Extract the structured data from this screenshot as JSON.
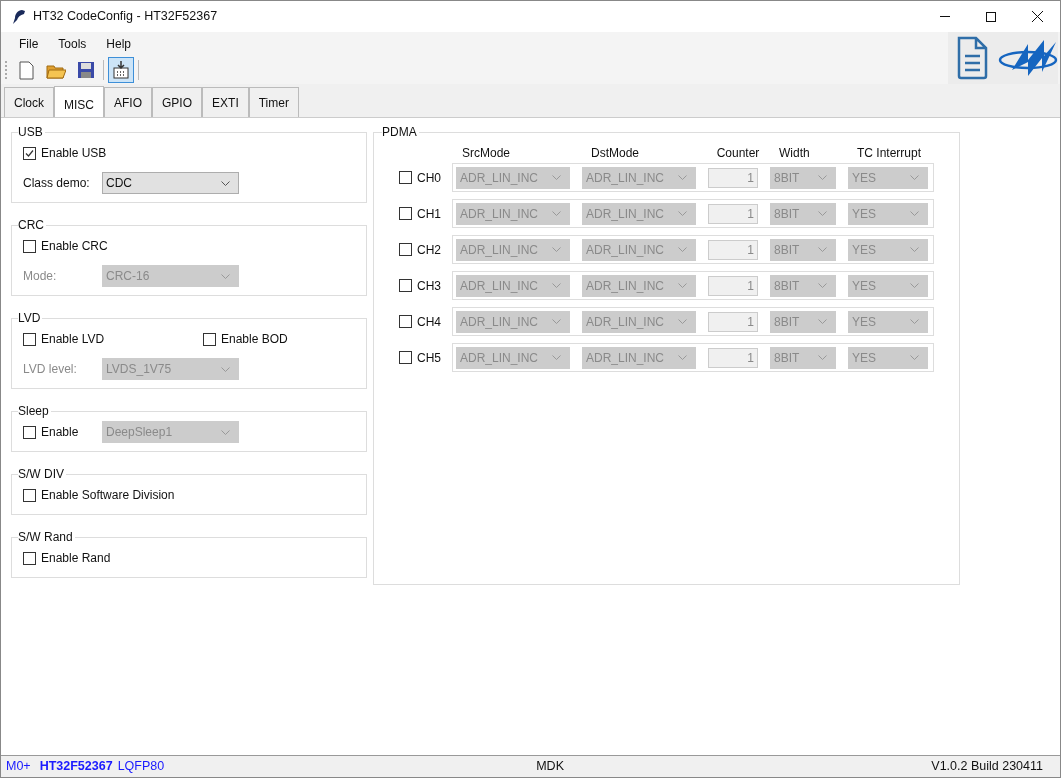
{
  "window": {
    "title": "HT32 CodeConfig - HT32F52367"
  },
  "menu": [
    "File",
    "Tools",
    "Help"
  ],
  "toolbar": [
    {
      "kind": "new",
      "highlighted": false
    },
    {
      "kind": "open",
      "highlighted": false
    },
    {
      "kind": "save",
      "highlighted": false
    },
    {
      "kind": "generate",
      "highlighted": true
    }
  ],
  "tabs": [
    {
      "label": "Clock",
      "selected": false
    },
    {
      "label": "MISC",
      "selected": true
    },
    {
      "label": "AFIO",
      "selected": false
    },
    {
      "label": "GPIO",
      "selected": false
    },
    {
      "label": "EXTI",
      "selected": false
    },
    {
      "label": "Timer",
      "selected": false
    }
  ],
  "groups": [
    {
      "title": "USB",
      "rows": [
        [
          {
            "kind": "checkbox",
            "label": "Enable USB",
            "checked": true
          }
        ],
        [
          {
            "kind": "select",
            "label": "Class demo:",
            "value": "CDC",
            "disabled": false
          }
        ]
      ]
    },
    {
      "title": "CRC",
      "rows": [
        [
          {
            "kind": "checkbox",
            "label": "Enable CRC",
            "checked": false
          }
        ],
        [
          {
            "kind": "select",
            "label": "Mode:",
            "value": "CRC-16",
            "disabled": true
          }
        ]
      ]
    },
    {
      "title": "LVD",
      "rows": [
        [
          {
            "kind": "checkbox",
            "label": "Enable LVD",
            "checked": false
          },
          {
            "kind": "checkbox",
            "label": "Enable BOD",
            "checked": false
          }
        ],
        [
          {
            "kind": "select",
            "label": "LVD level:",
            "value": "LVDS_1V75",
            "disabled": true
          }
        ]
      ]
    },
    {
      "title": "Sleep",
      "rows": [
        [
          {
            "kind": "checkbox",
            "label": "Enable",
            "checked": false
          },
          {
            "kind": "select",
            "value": "DeepSleep1",
            "disabled": true
          }
        ]
      ]
    },
    {
      "title": "S/W DIV",
      "rows": [
        [
          {
            "kind": "checkbox",
            "label": "Enable Software Division",
            "checked": false
          }
        ]
      ]
    },
    {
      "title": "S/W Rand",
      "rows": [
        [
          {
            "kind": "checkbox",
            "label": "Enable Rand",
            "checked": false
          }
        ]
      ]
    }
  ],
  "pdma": {
    "title": "PDMA",
    "columns": [
      "SrcMode",
      "DstMode",
      "Counter",
      "Width",
      "TC Interrupt"
    ],
    "channels": [
      {
        "label": "CH0",
        "checked": false,
        "src_mode": "ADR_LIN_INC",
        "dst_mode": "ADR_LIN_INC",
        "counter": "1",
        "width": "8BIT",
        "tc_interrupt": "YES"
      },
      {
        "label": "CH1",
        "checked": false,
        "src_mode": "ADR_LIN_INC",
        "dst_mode": "ADR_LIN_INC",
        "counter": "1",
        "width": "8BIT",
        "tc_interrupt": "YES"
      },
      {
        "label": "CH2",
        "checked": false,
        "src_mode": "ADR_LIN_INC",
        "dst_mode": "ADR_LIN_INC",
        "counter": "1",
        "width": "8BIT",
        "tc_interrupt": "YES"
      },
      {
        "label": "CH3",
        "checked": false,
        "src_mode": "ADR_LIN_INC",
        "dst_mode": "ADR_LIN_INC",
        "counter": "1",
        "width": "8BIT",
        "tc_interrupt": "YES"
      },
      {
        "label": "CH4",
        "checked": false,
        "src_mode": "ADR_LIN_INC",
        "dst_mode": "ADR_LIN_INC",
        "counter": "1",
        "width": "8BIT",
        "tc_interrupt": "YES"
      },
      {
        "label": "CH5",
        "checked": false,
        "src_mode": "ADR_LIN_INC",
        "dst_mode": "ADR_LIN_INC",
        "counter": "1",
        "width": "8BIT",
        "tc_interrupt": "YES"
      }
    ]
  },
  "status_bar": {
    "core": "M0+",
    "chip": "HT32F52367",
    "package": "LQFP80",
    "toolchain": "MDK",
    "version": "V1.0.2 Build 230411"
  }
}
